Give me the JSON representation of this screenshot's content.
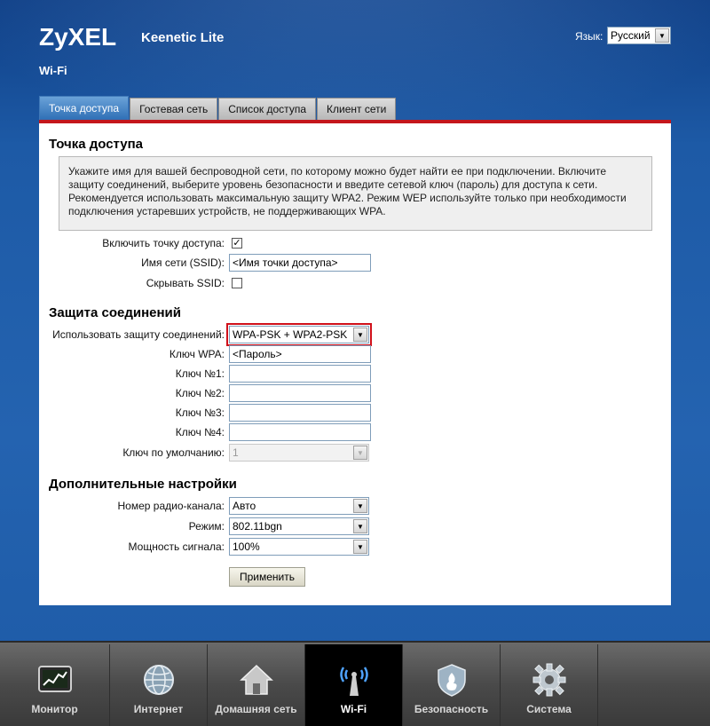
{
  "header": {
    "brand": "ZyXEL",
    "product": "Keenetic Lite",
    "language_label": "Язык:",
    "language_value": "Русский",
    "page_title": "Wi-Fi"
  },
  "tabs": [
    {
      "label": "Точка доступа",
      "active": true
    },
    {
      "label": "Гостевая сеть",
      "active": false
    },
    {
      "label": "Список доступа",
      "active": false
    },
    {
      "label": "Клиент сети",
      "active": false
    }
  ],
  "access_point": {
    "title": "Точка доступа",
    "info_text": "Укажите имя для вашей беспроводной сети, по которому можно будет найти ее при подключении. Включите защиту соединений, выберите уровень безопасности и введите сетевой ключ (пароль) для доступа к сети. Рекомендуется использовать максимальную защиту WPA2. Режим WEP используйте только при необходимости подключения устаревших устройств, не поддерживающих WPA.",
    "enable_label": "Включить точку доступа:",
    "enable_checked": "✓",
    "ssid_label": "Имя сети (SSID):",
    "ssid_value": "<Имя точки доступа>",
    "hide_ssid_label": "Скрывать SSID:"
  },
  "security": {
    "title": "Защита соединений",
    "protection_label": "Использовать защиту соединений:",
    "protection_value": "WPA-PSK + WPA2-PSK",
    "wpa_key_label": "Ключ WPA:",
    "wpa_key_value": "<Пароль>",
    "key1_label": "Ключ №1:",
    "key2_label": "Ключ №2:",
    "key3_label": "Ключ №3:",
    "key4_label": "Ключ №4:",
    "default_key_label": "Ключ по умолчанию:",
    "default_key_value": "1"
  },
  "advanced": {
    "title": "Дополнительные настройки",
    "channel_label": "Номер радио-канала:",
    "channel_value": "Авто",
    "mode_label": "Режим:",
    "mode_value": "802.11bgn",
    "power_label": "Мощность сигнала:",
    "power_value": "100%",
    "apply_label": "Применить"
  },
  "bottom_nav": [
    {
      "label": "Монитор",
      "icon": "monitor-icon"
    },
    {
      "label": "Интернет",
      "icon": "globe-icon"
    },
    {
      "label": "Домашняя сеть",
      "icon": "home-icon"
    },
    {
      "label": "Wi-Fi",
      "icon": "wifi-icon",
      "active": true
    },
    {
      "label": "Безопасность",
      "icon": "shield-icon"
    },
    {
      "label": "Система",
      "icon": "gear-icon"
    }
  ],
  "colors": {
    "accent_red": "#c4161c",
    "active_tab": "#2f6fb6",
    "background_blue": "#1f5da8"
  }
}
